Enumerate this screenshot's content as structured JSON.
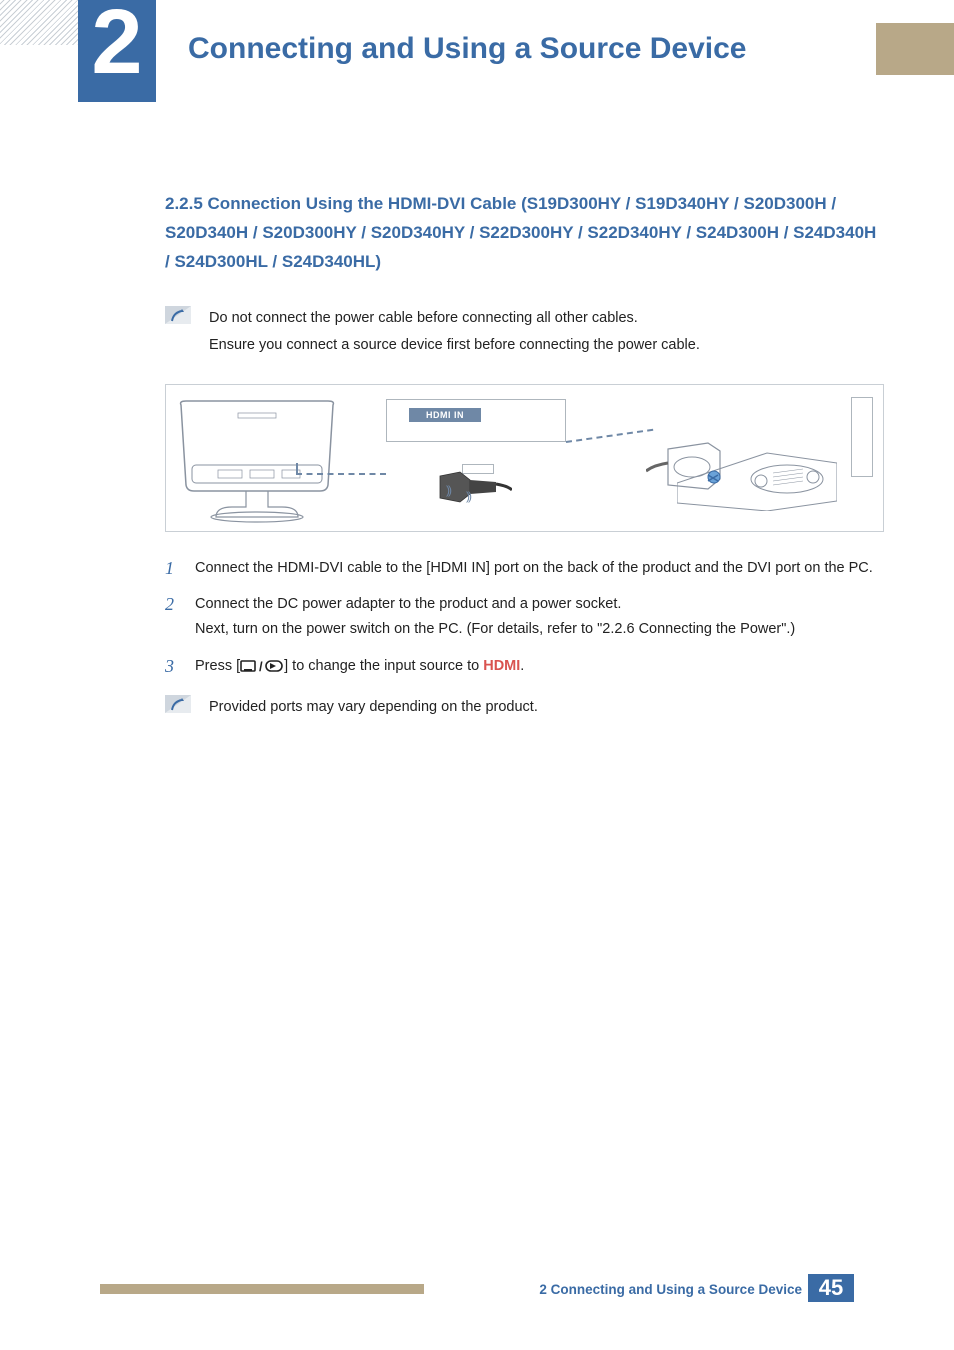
{
  "header": {
    "chapter_number": "2",
    "chapter_title": "Connecting and Using a Source Device"
  },
  "section_heading": "2.2.5   Connection Using the HDMI-DVI Cable (S19D300HY / S19D340HY / S20D300H / S20D340H / S20D300HY / S20D340HY / S22D300HY / S22D340HY / S24D300H / S24D340H / S24D300HL / S24D340HL)",
  "note1_line1": "Do not connect the power cable before connecting all other cables.",
  "note1_line2": "Ensure you connect a source device first before connecting the power cable.",
  "diagram": {
    "hdmi_label": "HDMI IN"
  },
  "steps": {
    "s1_num": "1",
    "s1_text": "Connect the HDMI-DVI cable to the [HDMI IN] port on the back of the product and the DVI port on the PC.",
    "s2_num": "2",
    "s2_text_a": "Connect the DC power adapter to the product and a power socket.",
    "s2_text_b": "Next, turn on the power switch on the PC. (For details, refer to \"2.2.6    Connecting the Power\".)",
    "s3_num": "3",
    "s3_prefix": "Press [",
    "s3_mid": "] to change the input source to ",
    "s3_hdmi": "HDMI",
    "s3_period": "."
  },
  "note2": "Provided ports may vary depending on the product.",
  "footer": {
    "label": "2 Connecting and Using a Source Device",
    "page": "45"
  }
}
